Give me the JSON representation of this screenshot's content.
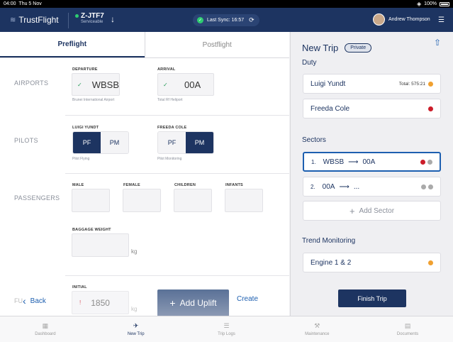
{
  "status_bar": {
    "time": "04:00",
    "date": "Thu 5 Nov",
    "battery": "100%"
  },
  "header": {
    "logo_text": "TrustFlight",
    "aircraft_reg": "Z-JTF7",
    "aircraft_status": "Serviceable",
    "sync_text": "Last Sync: 16:57",
    "user_name": "Andrew Thompson"
  },
  "tabs": {
    "preflight": "Preflight",
    "postflight": "Postflight"
  },
  "airports": {
    "section": "AIRPORTS",
    "departure_label": "DEPARTURE",
    "departure_value": "WBSB",
    "departure_caption": "Brunei International Airport",
    "arrival_label": "ARRIVAL",
    "arrival_value": "00A",
    "arrival_caption": "Total Rf Heliport"
  },
  "pilots": {
    "section": "PILOTS",
    "pilot1_label": "LUIGI YUNDT",
    "pilot1_caption": "Pilot Flying",
    "pilot2_label": "FREEDA COLE",
    "pilot2_caption": "Pilot Monitoring",
    "pf": "PF",
    "pm": "PM"
  },
  "passengers": {
    "section": "PASSENGERS",
    "male": "MALE",
    "female": "FEMALE",
    "children": "CHILDREN",
    "infants": "INFANTS",
    "baggage_label": "BAGGAGE WEIGHT",
    "baggage_unit": "kg"
  },
  "fuel": {
    "section": "FU",
    "initial_label": "INITIAL",
    "initial_value": "1850",
    "unit": "kg"
  },
  "bottom_actions": {
    "back": "Back",
    "add_uplift": "Add Uplift",
    "create": "Create"
  },
  "trip": {
    "title": "New Trip",
    "badge": "Private",
    "duty_label": "Duty",
    "duty": [
      {
        "name": "Luigi Yundt",
        "total": "Total: 575:21",
        "color": "#f0a030"
      },
      {
        "name": "Freeda Cole",
        "total": "",
        "color": "#cc1d2a"
      }
    ],
    "sectors_label": "Sectors",
    "sectors": [
      {
        "num": "1.",
        "from": "WBSB",
        "to": "00A"
      },
      {
        "num": "2.",
        "from": "00A",
        "to": "..."
      }
    ],
    "add_sector": "Add Sector",
    "trend_label": "Trend Monitoring",
    "trend_item": "Engine 1 & 2",
    "finish": "Finish Trip"
  },
  "bottom_nav": [
    {
      "label": "Dashboard"
    },
    {
      "label": "New Trip"
    },
    {
      "label": "Trip Logs"
    },
    {
      "label": "Maintenance"
    },
    {
      "label": "Documents"
    }
  ],
  "colors": {
    "navy": "#1d3461",
    "accent_blue": "#1d5fb0",
    "ok_green": "#2ecc71",
    "alert_red": "#cc1d2a",
    "warn_orange": "#f0a030"
  }
}
